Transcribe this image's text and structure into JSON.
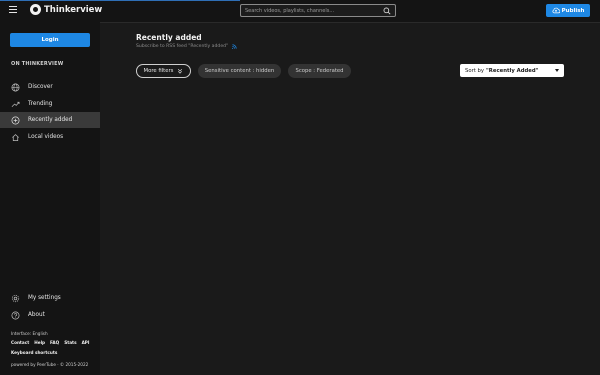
{
  "header": {
    "brand": "Thinkerview",
    "search_placeholder": "Search videos, playlists, channels…",
    "publish_label": "Publish"
  },
  "sidebar": {
    "login_label": "Login",
    "section_heading": "ON THINKERVIEW",
    "items": [
      {
        "label": "Discover",
        "icon": "globe-icon"
      },
      {
        "label": "Trending",
        "icon": "trending-icon"
      },
      {
        "label": "Recently added",
        "icon": "plus-circle-icon"
      },
      {
        "label": "Local videos",
        "icon": "home-icon"
      }
    ],
    "settings_label": "My settings",
    "about_label": "About",
    "footer": {
      "interface_lang": "Interface: English",
      "links": [
        "Contact",
        "Help",
        "FAQ",
        "Stats",
        "API"
      ],
      "keyboard": "Keyboard shortcuts",
      "powered": "powered by PeerTube · © 2015-2022"
    }
  },
  "main": {
    "title": "Recently added",
    "subscribe_text": "Subscribe to RSS feed \"Recently added\"",
    "filters": {
      "more_filters": "More filters",
      "sensitive": "Sensitive content : hidden",
      "scope": "Scope : Federated"
    },
    "sort": {
      "prefix": "Sort by",
      "value": "\"Recently Added\""
    }
  },
  "colors": {
    "accent": "#1e88e5",
    "background": "#1a1a1a",
    "sidebar": "#141414",
    "active_item": "#3a3a3a"
  }
}
